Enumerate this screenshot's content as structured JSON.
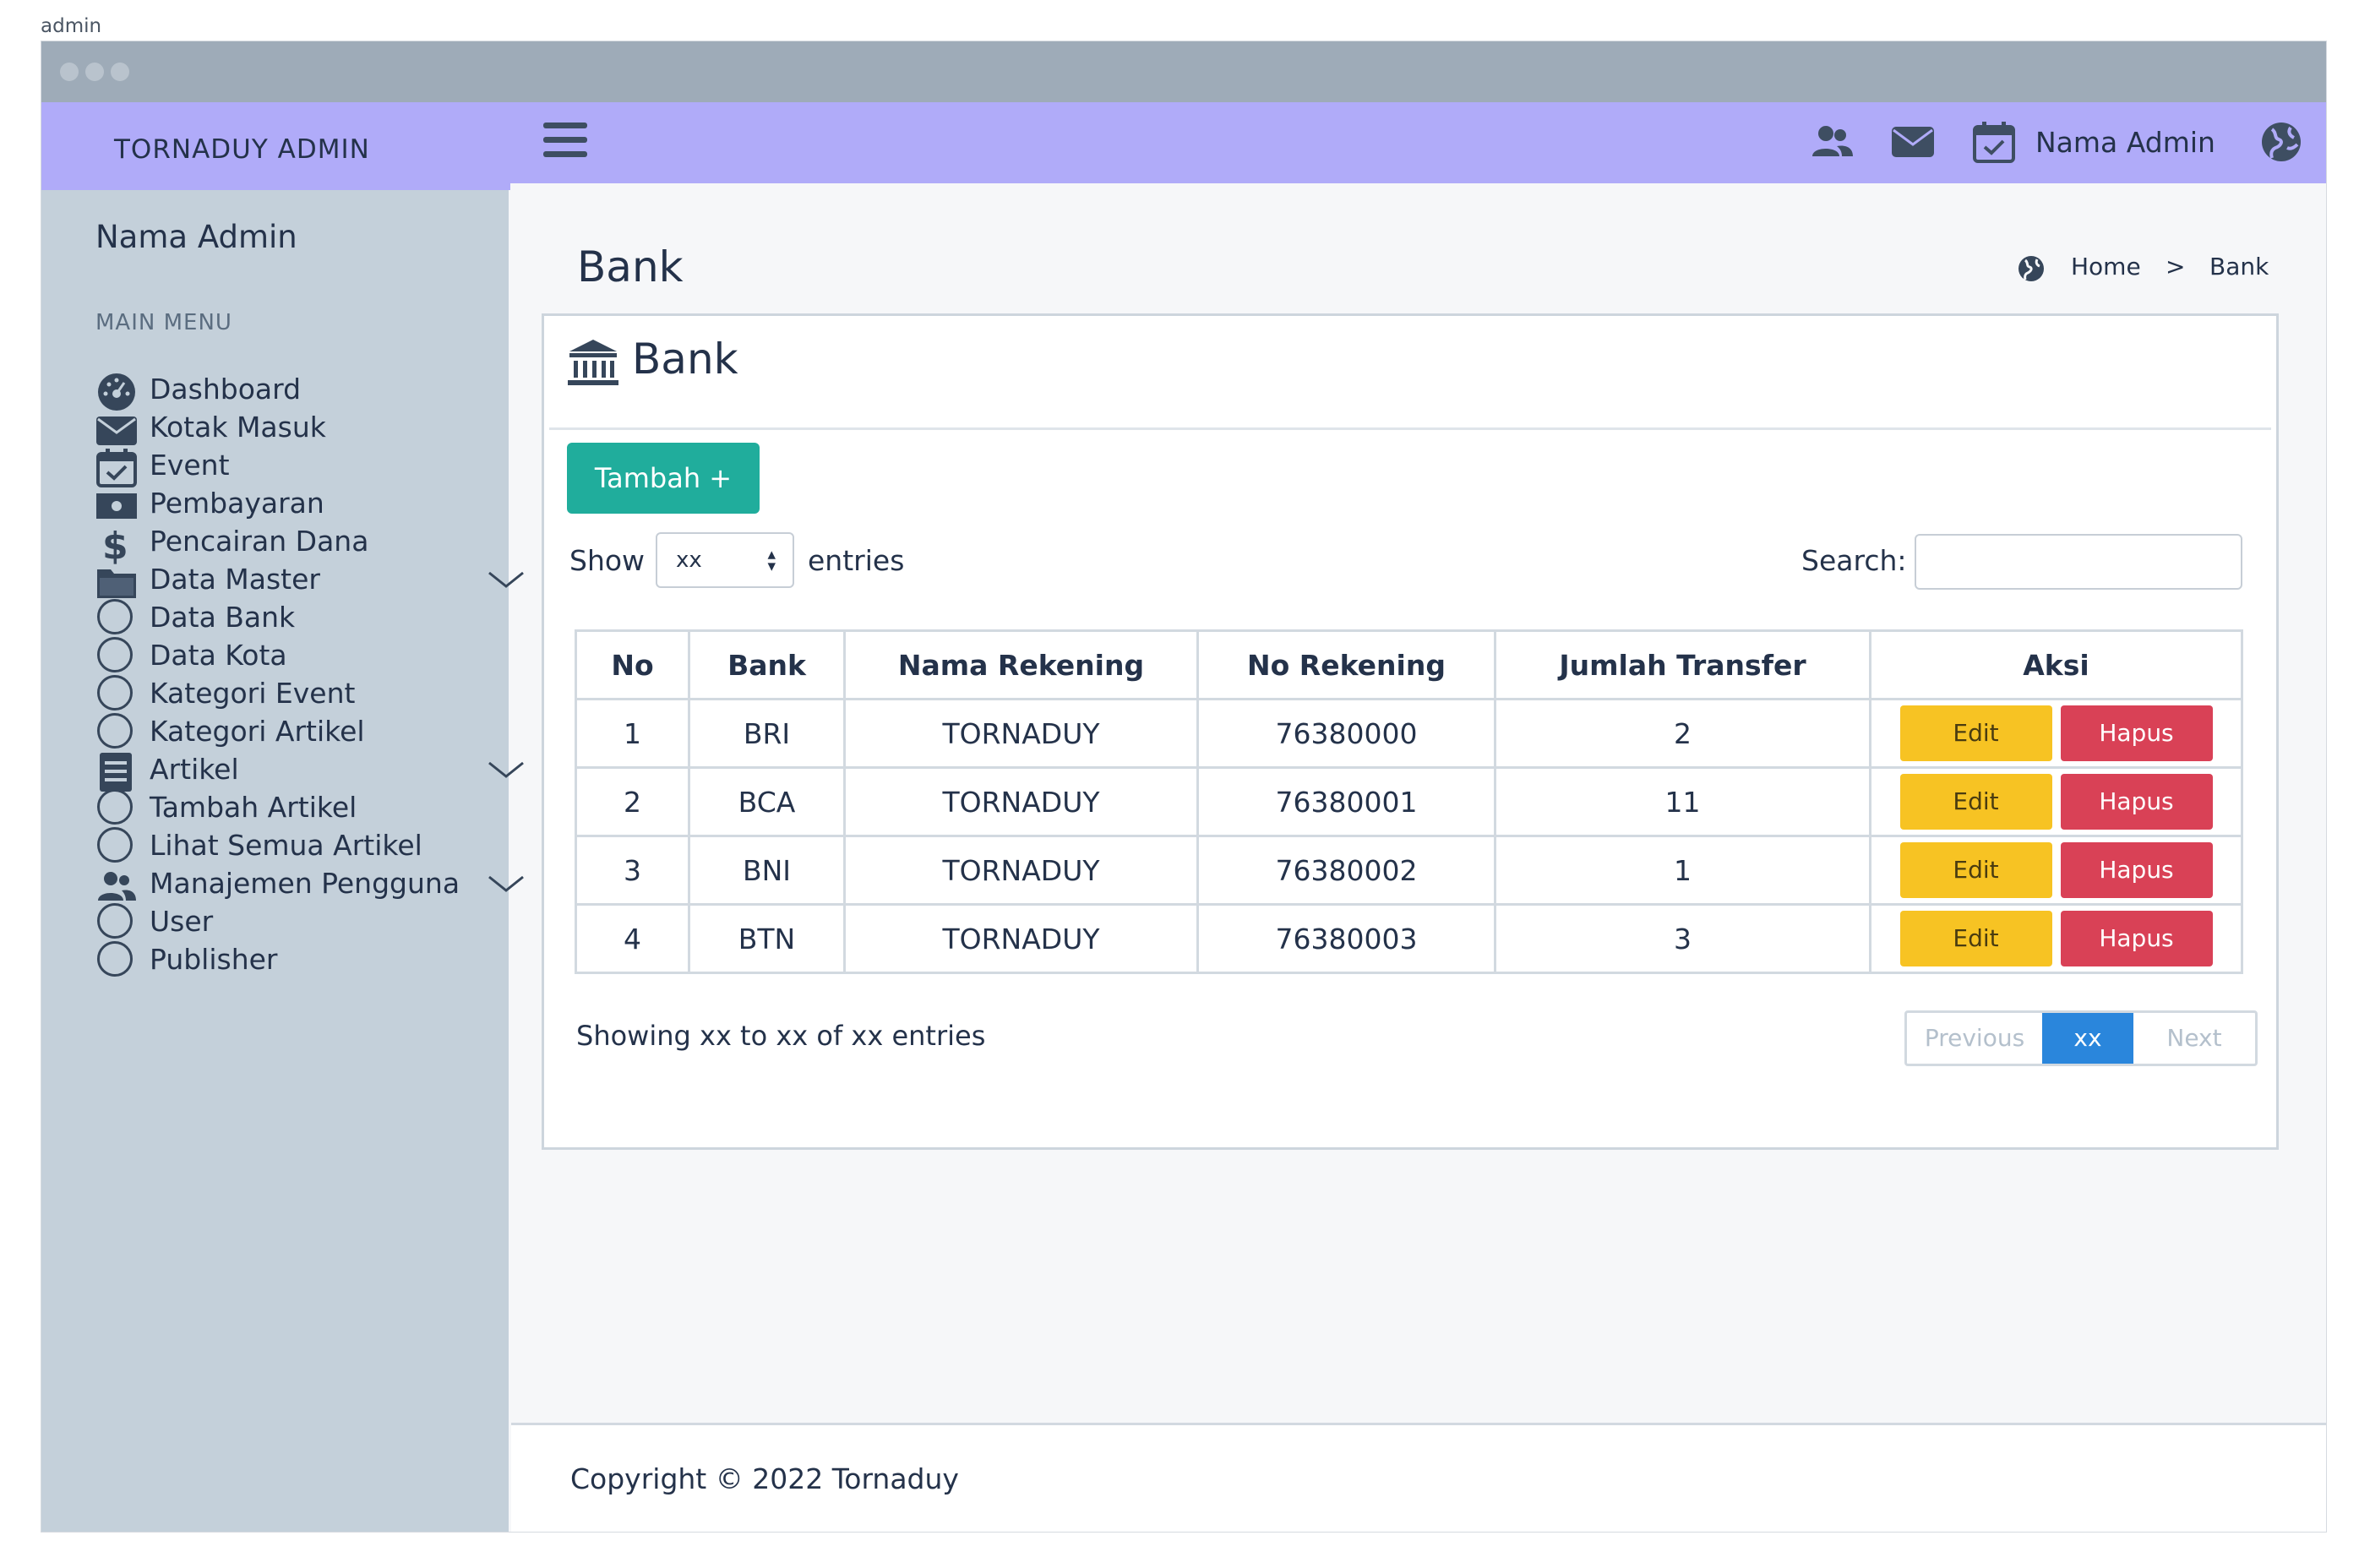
{
  "page_label": "admin",
  "colors": {
    "titlebar": "#9eabb8",
    "topnav": "#b0abf9",
    "sidebar": "#c4d0da",
    "add_button": "#20ad9c",
    "edit_button": "#f7c323",
    "delete_button": "#d94156",
    "active_page": "#2a86dc"
  },
  "topnav": {
    "brand": "TORNADUY ADMIN",
    "menu_icon": "hamburger-icon",
    "icons": [
      "users-icon",
      "envelope-icon",
      "calendar-check-icon"
    ],
    "user_name": "Nama Admin",
    "profile_icon": "globe-icon"
  },
  "sidebar": {
    "user_name": "Nama Admin",
    "header": "MAIN MENU",
    "items": [
      {
        "label": "Dashboard",
        "icon": "dashboard-icon"
      },
      {
        "label": "Kotak Masuk",
        "icon": "envelope-icon"
      },
      {
        "label": "Event",
        "icon": "calendar-check-icon"
      },
      {
        "label": "Pembayaran",
        "icon": "money-icon"
      },
      {
        "label": "Pencairan Dana",
        "icon": "dollar-icon"
      },
      {
        "label": "Data Master",
        "icon": "folder-icon",
        "expandable": true
      },
      {
        "label": "Data Bank",
        "icon": "circle-icon"
      },
      {
        "label": "Data Kota",
        "icon": "circle-icon"
      },
      {
        "label": "Kategori Event",
        "icon": "circle-icon"
      },
      {
        "label": "Kategori Artikel",
        "icon": "circle-icon"
      },
      {
        "label": "Artikel",
        "icon": "book-icon",
        "expandable": true
      },
      {
        "label": "Tambah Artikel",
        "icon": "circle-icon"
      },
      {
        "label": "Lihat Semua Artikel",
        "icon": "circle-icon"
      },
      {
        "label": "Manajemen Pengguna",
        "icon": "users-icon",
        "expandable": true
      },
      {
        "label": "User",
        "icon": "circle-icon"
      },
      {
        "label": "Publisher",
        "icon": "circle-icon"
      }
    ]
  },
  "content": {
    "title": "Bank",
    "breadcrumb": {
      "home": "Home",
      "separator": ">",
      "current": "Bank"
    }
  },
  "card": {
    "title": "Bank",
    "icon": "bank-icon",
    "add_button": "Tambah +",
    "show_label": "Show",
    "entries_value": "xx",
    "entries_label": "entries",
    "search_label": "Search:",
    "search_value": "",
    "columns": [
      "No",
      "Bank",
      "Nama Rekening",
      "No Rekening",
      "Jumlah Transfer",
      "Aksi"
    ],
    "rows": [
      {
        "no": "1",
        "bank": "BRI",
        "nama": "TORNADUY",
        "rekening": "76380000",
        "jumlah": "2",
        "edit": "Edit",
        "hapus": "Hapus"
      },
      {
        "no": "2",
        "bank": "BCA",
        "nama": "TORNADUY",
        "rekening": "76380001",
        "jumlah": "11",
        "edit": "Edit",
        "hapus": "Hapus"
      },
      {
        "no": "3",
        "bank": "BNI",
        "nama": "TORNADUY",
        "rekening": "76380002",
        "jumlah": "1",
        "edit": "Edit",
        "hapus": "Hapus"
      },
      {
        "no": "4",
        "bank": "BTN",
        "nama": "TORNADUY",
        "rekening": "76380003",
        "jumlah": "3",
        "edit": "Edit",
        "hapus": "Hapus"
      }
    ],
    "info": "Showing xx to xx of xx entries",
    "pagination": {
      "previous": "Previous",
      "current": "xx",
      "next": "Next"
    }
  },
  "footer": {
    "text": "Copyright © 2022 Tornaduy"
  }
}
